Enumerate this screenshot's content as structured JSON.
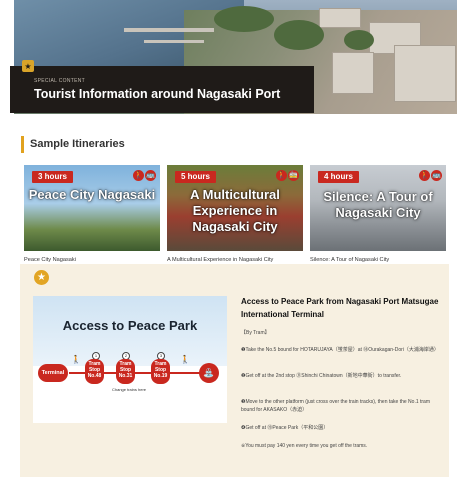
{
  "hero": {
    "kicker": "SPECIAL CONTENT",
    "title": "Tourist Information around Nagasaki Port"
  },
  "section": {
    "title": "Sample Itineraries"
  },
  "cards": [
    {
      "badge": "3 hours",
      "title": "Peace City Nagasaki",
      "caption": "Peace City Nagasaki",
      "modes": [
        "walk-icon",
        "bus-icon"
      ]
    },
    {
      "badge": "5 hours",
      "title": "A Multicultural Experience in Nagasaki City",
      "caption": "A Multicultural Experience in Nagasaki City",
      "modes": [
        "walk-icon",
        "tram-icon"
      ]
    },
    {
      "badge": "4 hours",
      "title": "Silence: A Tour of Nagasaki City",
      "caption": "Silence: A Tour of Nagasaki City",
      "modes": [
        "walk-icon",
        "bus-icon"
      ]
    }
  ],
  "detail": {
    "map_title": "Access to Peace Park",
    "route": {
      "start": "Terminal",
      "stops": [
        {
          "label": "Tram Stop",
          "num": "No.48"
        },
        {
          "label": "Tram Stop",
          "num": "No.31"
        },
        {
          "label": "Tram Stop",
          "num": "No.19"
        }
      ],
      "change_note": "Change trains here",
      "numbers": [
        "1",
        "2",
        "3"
      ]
    },
    "title": "Access to Peace Park from Nagasaki Port Matsugae International Terminal",
    "by": "【By Tram】",
    "steps": [
      "❶Take the No.5 bound for HOTARUJAYA（蛍茶屋）at ⑱Ourakagan-Dori（大浦海岸通）",
      "❷Get off at the 2nd stop ㉛Shinchi Chinatown（新地中華街）to transfer.",
      "❸Move to the other platform (just cross over the train tracks), then take the No.1 tram bound for AKASAKO（赤迫）",
      "❹Get off at ⑲Peace Park（平和公園）",
      "※You must pay 140 yen every time you get off the trams."
    ]
  },
  "colors": {
    "accent": "#e1a21f",
    "badge": "#c9281f",
    "panel": "#f7f0e1",
    "hero_label": "#1f1b18"
  }
}
